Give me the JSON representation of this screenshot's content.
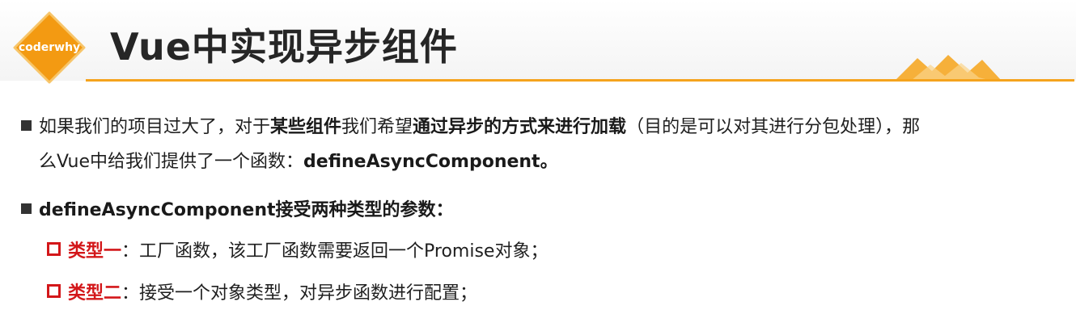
{
  "header": {
    "logo_text": "coderwhy",
    "title": "Vue中实现异步组件",
    "accent_color": "#f5a31d"
  },
  "bullets": [
    {
      "line1_parts": [
        {
          "text": "如果我们的项目过大了，对于",
          "bold": false
        },
        {
          "text": "某些组件",
          "bold": true
        },
        {
          "text": "我们希望",
          "bold": false
        },
        {
          "text": "通过异步的方式来进行加载",
          "bold": true
        },
        {
          "text": "（目的是可以对其进行分包处理），那",
          "bold": false
        }
      ],
      "line2_parts": [
        {
          "text": "么Vue中给我们提供了一个函数：",
          "bold": false
        },
        {
          "text": "defineAsyncComponent。",
          "bold": true
        }
      ]
    },
    {
      "text": "defineAsyncComponent接受两种类型的参数：",
      "sub_items": [
        {
          "label": "类型一",
          "text": "：工厂函数，该工厂函数需要返回一个Promise对象；"
        },
        {
          "label": "类型二",
          "text": "：接受一个对象类型，对异步函数进行配置；"
        }
      ]
    }
  ]
}
